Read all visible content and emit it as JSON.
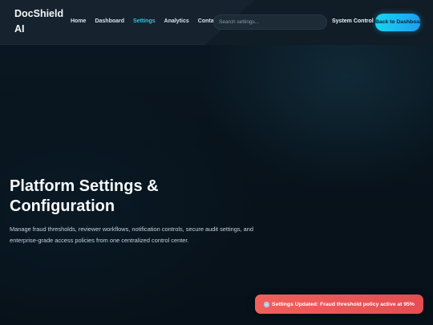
{
  "brand": {
    "name": "DocShield AI"
  },
  "nav": {
    "links": [
      {
        "label": "Home",
        "active": false
      },
      {
        "label": "Dashboard",
        "active": false
      },
      {
        "label": "Settings",
        "active": true
      },
      {
        "label": "Analytics",
        "active": false
      },
      {
        "label": "Contact",
        "active": false
      }
    ],
    "search_placeholder": "Search settings...",
    "system_control_label": "System Control",
    "back_button_label": "Back to Dashboard"
  },
  "hero": {
    "title": "Platform Settings & Configuration",
    "description": "Manage fraud thresholds, reviewer workflows, notification controls, secure audit settings, and enterprise-grade access policies from one centralized control center."
  },
  "toast": {
    "icon": "gear-icon",
    "text": "Settings Updated: Fraud threshold policy active at 95%"
  },
  "colors": {
    "accent": "#2cc4de",
    "button_gradient_start": "#1ad3f0",
    "toast_background": "#ee5a5a"
  }
}
